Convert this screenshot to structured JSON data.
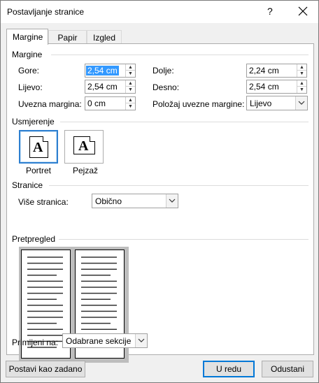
{
  "window": {
    "title": "Postavljanje stranice",
    "help": "?"
  },
  "tabs": [
    "Margine",
    "Papir",
    "Izgled"
  ],
  "margins": {
    "group_label": "Margine",
    "top_label": "Gore:",
    "top_value": "2,54 cm",
    "bottom_label": "Dolje:",
    "bottom_value": "2,24 cm",
    "left_label": "Lijevo:",
    "left_value": "2,54 cm",
    "right_label": "Desno:",
    "right_value": "2,54 cm",
    "gutter_label": "Uvezna margina:",
    "gutter_value": "0 cm",
    "gutter_pos_label": "Položaj uvezne margine:",
    "gutter_pos_value": "Lijevo"
  },
  "orientation": {
    "group_label": "Usmjerenje",
    "portrait_label": "Portret",
    "landscape_label": "Pejzaž",
    "glyph": "A",
    "selected": "portrait"
  },
  "pages": {
    "group_label": "Stranice",
    "multiple_label": "Više stranica:",
    "multiple_value": "Obično"
  },
  "preview": {
    "group_label": "Pretpregled",
    "apply_label": "Primijeni na:",
    "apply_value": "Odabrane sekcije"
  },
  "buttons": {
    "set_default": "Postavi kao zadano",
    "ok": "U redu",
    "cancel": "Odustani"
  }
}
